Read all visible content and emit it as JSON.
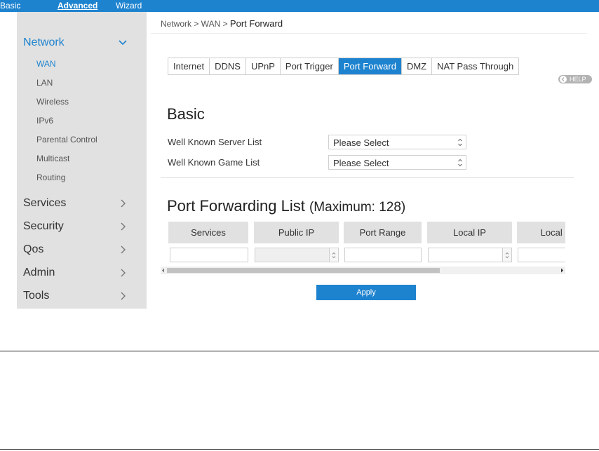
{
  "topnav": {
    "basic": "Basic",
    "advanced": "Advanced",
    "wizard": "Wizard"
  },
  "sidebar": {
    "network": "Network",
    "network_sub": [
      "WAN",
      "LAN",
      "Wireless",
      "IPv6",
      "Parental Control",
      "Multicast",
      "Routing"
    ],
    "others": [
      "Services",
      "Security",
      "Qos",
      "Admin",
      "Tools"
    ]
  },
  "breadcrumb": {
    "path": "Network > WAN > ",
    "current": "Port Forward"
  },
  "tabs": [
    "Internet",
    "DDNS",
    "UPnP",
    "Port Trigger",
    "Port Forward",
    "DMZ",
    "NAT Pass Through"
  ],
  "active_tab": "Port Forward",
  "help": "HELP",
  "basic": {
    "heading": "Basic",
    "server_label": "Well Known Server List",
    "server_value": "Please Select",
    "game_label": "Well Known Game List",
    "game_value": "Please Select"
  },
  "pfl": {
    "heading": "Port Forwarding List",
    "max": "(Maximum: 128)",
    "columns": [
      "Services",
      "Public IP",
      "Port Range",
      "Local IP",
      "Local F"
    ]
  },
  "apply": "Apply",
  "colors": {
    "accent": "#1e83cf",
    "sidebar_bg": "#e1e1e1"
  }
}
